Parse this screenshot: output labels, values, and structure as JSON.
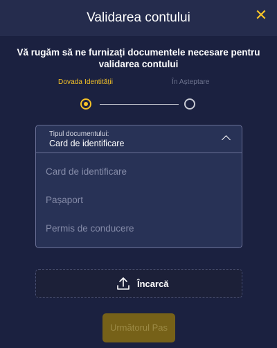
{
  "header": {
    "title": "Validarea contului",
    "close": "✕"
  },
  "subtitle": "Vă rugăm să ne furnizați documentele necesare pentru validarea contului",
  "steps": [
    {
      "label": "Dovada Identității",
      "state": "active"
    },
    {
      "label": "În Așteptare",
      "state": "pending"
    }
  ],
  "select": {
    "caption": "Tipul documentului:",
    "value": "Card de identificare",
    "options": [
      "Card de identificare",
      "Pașaport",
      "Permis de conducere"
    ]
  },
  "upload": {
    "label": "Încarcă",
    "icon": "upload-icon"
  },
  "next_button": "Următorul Pas",
  "colors": {
    "accent": "#f5c228",
    "background": "#1b2140",
    "header": "#252c4d"
  }
}
